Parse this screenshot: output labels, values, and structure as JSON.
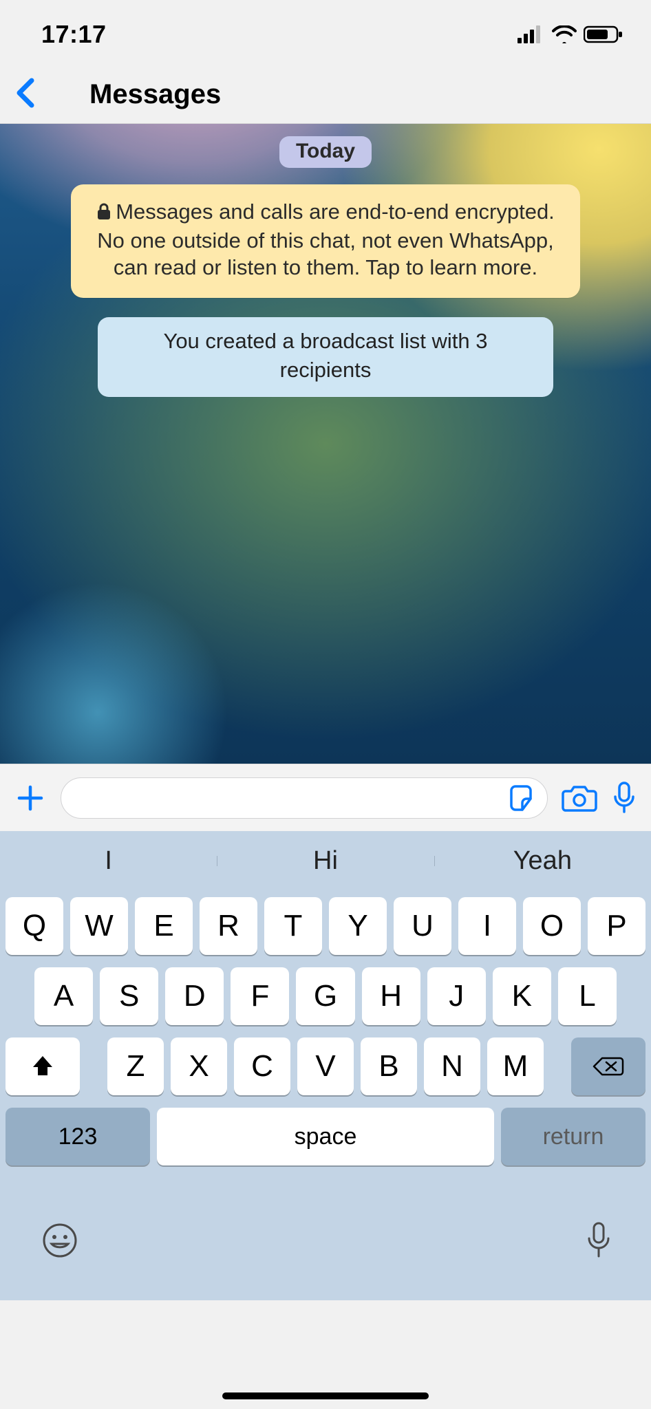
{
  "status": {
    "time": "17:17"
  },
  "header": {
    "title": "Messages"
  },
  "chat": {
    "date_label": "Today",
    "encryption_notice": "Messages and calls are end-to-end encrypted. No one outside of this chat, not even WhatsApp, can read or listen to them. Tap to learn more.",
    "system_message": "You created a broadcast list with 3 recipients"
  },
  "input": {
    "value": "",
    "placeholder": ""
  },
  "suggestions": [
    "I",
    "Hi",
    "Yeah"
  ],
  "keyboard": {
    "row1": [
      "Q",
      "W",
      "E",
      "R",
      "T",
      "Y",
      "U",
      "I",
      "O",
      "P"
    ],
    "row2": [
      "A",
      "S",
      "D",
      "F",
      "G",
      "H",
      "J",
      "K",
      "L"
    ],
    "row3": [
      "Z",
      "X",
      "C",
      "V",
      "B",
      "N",
      "M"
    ],
    "numeric_label": "123",
    "space_label": "space",
    "return_label": "return"
  }
}
